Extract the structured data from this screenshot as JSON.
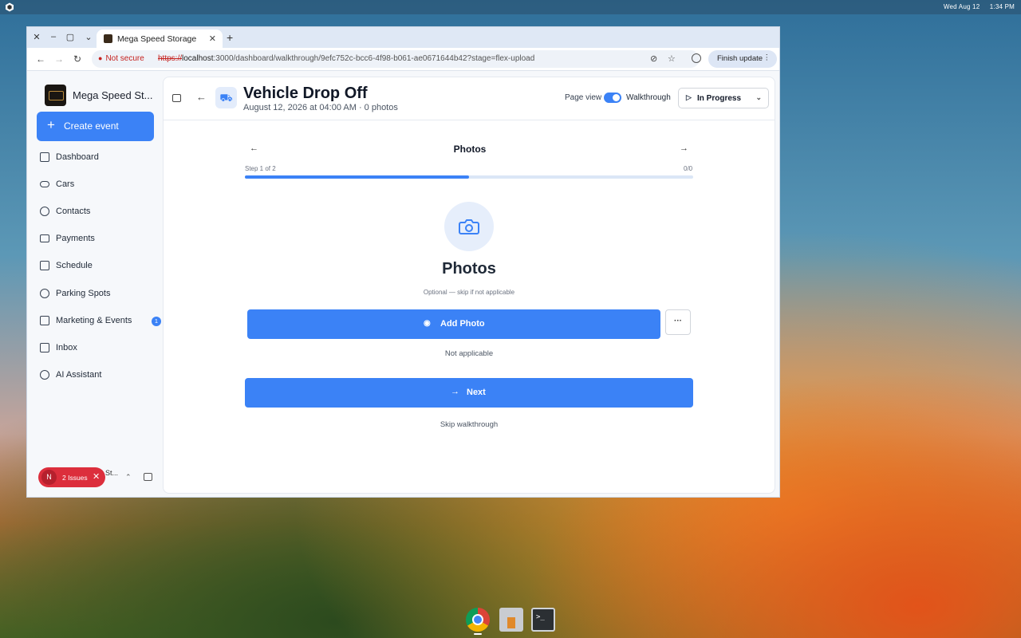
{
  "os": {
    "date": "Wed Aug 12",
    "time": "1:34 PM"
  },
  "browser": {
    "tab_title": "Mega Speed Storage",
    "security_label": "Not secure",
    "url_scheme": "https://",
    "url_host": "localhost",
    "url_rest": ":3000/dashboard/walkthrough/9efc752c-bcc6-4f98-b061-ae0671644b42?stage=flex-upload",
    "finish_update_label": "Finish update"
  },
  "sidebar": {
    "brand_name": "Mega Speed St...",
    "create_label": "Create event",
    "items": [
      {
        "label": "Dashboard",
        "icon": "grid-icon"
      },
      {
        "label": "Cars",
        "icon": "car-icon"
      },
      {
        "label": "Contacts",
        "icon": "users-icon"
      },
      {
        "label": "Payments",
        "icon": "card-icon"
      },
      {
        "label": "Schedule",
        "icon": "calendar-icon"
      },
      {
        "label": "Parking Spots",
        "icon": "pin-icon"
      },
      {
        "label": "Marketing & Events",
        "icon": "megaphone-icon",
        "badge": "1"
      },
      {
        "label": "Inbox",
        "icon": "message-icon"
      },
      {
        "label": "AI Assistant",
        "icon": "ai-icon"
      }
    ],
    "issues": {
      "avatar": "N",
      "label": "2 Issues"
    },
    "user_truncated": "St..."
  },
  "header": {
    "title": "Vehicle Drop Off",
    "subtitle": "August 12, 2026 at 04:00 AM · 0 photos",
    "page_view_label": "Page view",
    "walkthrough_label": "Walkthrough",
    "walkthrough_on": true,
    "status": "In Progress"
  },
  "walkthrough": {
    "step_title": "Photos",
    "step_label": "Step 1 of 2",
    "ratio": "0/0",
    "progress": 0.5,
    "heading": "Photos",
    "optional_text": "Optional — skip if not applicable",
    "add_photo_label": "Add Photo",
    "more_label": "···",
    "not_applicable_label": "Not applicable",
    "next_label": "Next",
    "skip_label": "Skip walkthrough"
  },
  "colors": {
    "accent": "#3b82f6",
    "danger": "#dc2e3c"
  }
}
